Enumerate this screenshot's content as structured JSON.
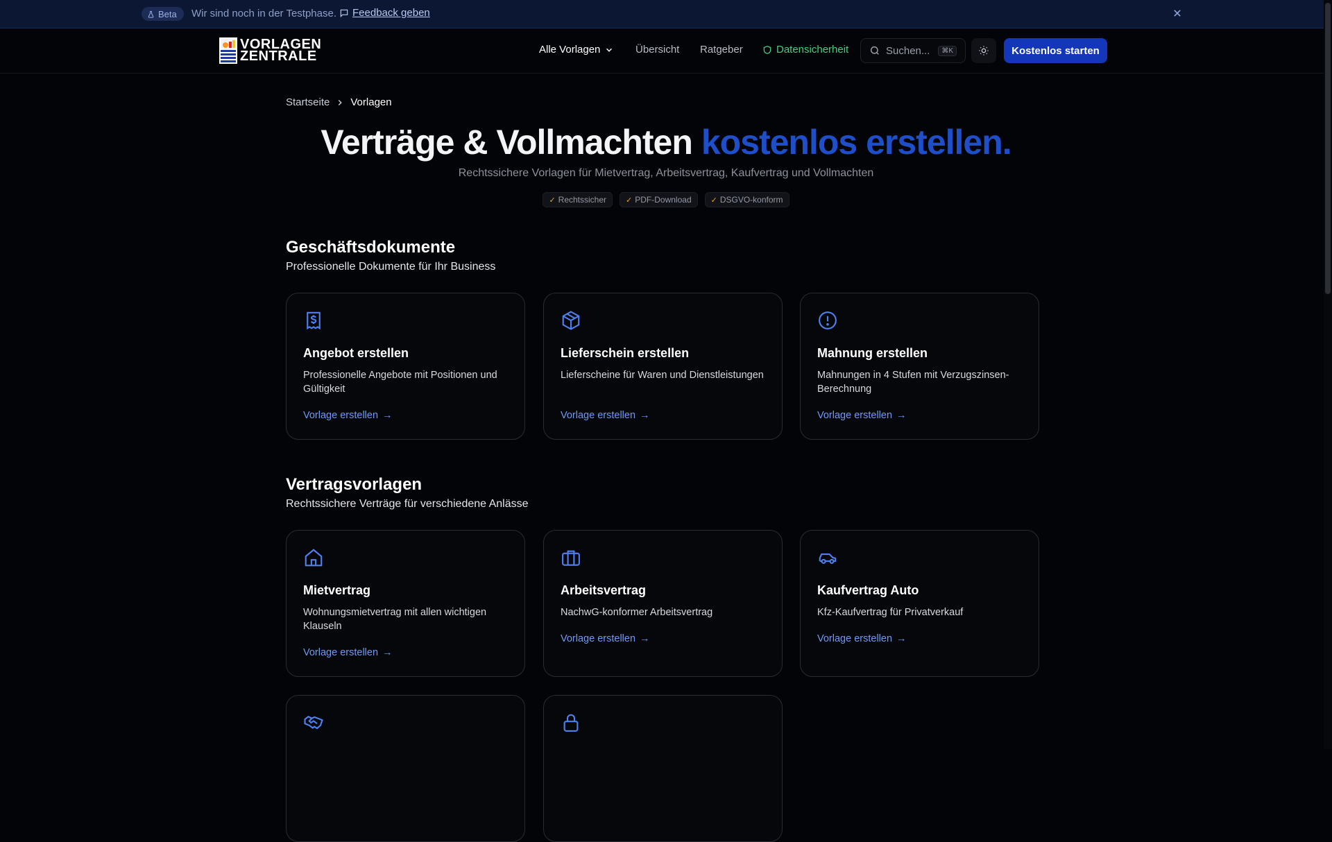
{
  "beta": {
    "badge": "Beta",
    "message": "Wir sind noch in der Testphase.",
    "feedback_link": "Feedback geben"
  },
  "nav": {
    "logo_line1": "VORLAGEN",
    "logo_line2": "ZENTRALE",
    "all_templates": "Alle Vorlagen",
    "overview": "Übersicht",
    "guide": "Ratgeber",
    "security": "Datensicherheit",
    "search_placeholder": "Suchen...",
    "search_shortcut": "⌘K",
    "cta": "Kostenlos starten"
  },
  "breadcrumb": {
    "home": "Startseite",
    "current": "Vorlagen"
  },
  "hero": {
    "title_main": "Verträge & Vollmachten",
    "title_accent": "kostenlos erstellen.",
    "subtitle": "Rechtssichere Vorlagen für Mietvertrag, Arbeitsvertrag, Kaufvertrag und Vollmachten",
    "chips": [
      "Rechtssicher",
      "PDF-Download",
      "DSGVO-konform"
    ]
  },
  "sections": [
    {
      "title": "Geschäftsdokumente",
      "subtitle": "Professionelle Dokumente für Ihr Business",
      "cards": [
        {
          "icon": "receipt-dollar-icon",
          "title": "Angebot erstellen",
          "desc": "Professionelle Angebote mit Positionen und Gültigkeit",
          "link": "Vorlage erstellen"
        },
        {
          "icon": "package-box-icon",
          "title": "Lieferschein erstellen",
          "desc": "Lieferscheine für Waren und Dienstleistungen",
          "link": "Vorlage erstellen"
        },
        {
          "icon": "alert-circle-icon",
          "title": "Mahnung erstellen",
          "desc": "Mahnungen in 4 Stufen mit Verzugszinsen-Berechnung",
          "link": "Vorlage erstellen"
        }
      ]
    },
    {
      "title": "Vertragsvorlagen",
      "subtitle": "Rechtssichere Verträge für verschiedene Anlässe",
      "cards": [
        {
          "icon": "house-icon",
          "title": "Mietvertrag",
          "desc": "Wohnungsmietvertrag mit allen wichtigen Klauseln",
          "link": "Vorlage erstellen"
        },
        {
          "icon": "briefcase-icon",
          "title": "Arbeitsvertrag",
          "desc": "NachwG-konformer Arbeitsvertrag",
          "link": "Vorlage erstellen"
        },
        {
          "icon": "car-icon",
          "title": "Kaufvertrag Auto",
          "desc": "Kfz-Kaufvertrag für Privatverkauf",
          "link": "Vorlage erstellen"
        },
        {
          "icon": "handshake-icon",
          "title": "",
          "desc": "",
          "link": ""
        },
        {
          "icon": "lock-icon",
          "title": "",
          "desc": "",
          "link": ""
        }
      ]
    }
  ],
  "colors": {
    "accent": "#1e4fc9",
    "cta": "#1436b8",
    "link": "#6f9bf5",
    "security": "#3fd17f",
    "icon": "#4e80f0"
  }
}
